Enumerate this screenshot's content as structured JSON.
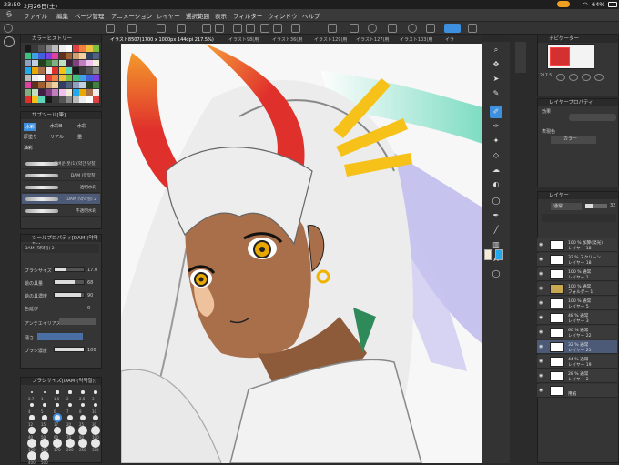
{
  "status": {
    "time": "23:50",
    "date": "2月26日(土)",
    "battery": "64%"
  },
  "menu": [
    "ファイル",
    "編集",
    "ページ管理",
    "アニメーション",
    "レイヤー",
    "選択範囲",
    "表示",
    "フィルター",
    "ウィンドウ",
    "ヘルプ"
  ],
  "tabs": [
    "イラスト8507(1700 x 1000px 144dpi 217.5%)",
    "イラスト98(用",
    "イラスト36(用",
    "イラスト129(用",
    "イラスト127(用",
    "イラスト103(用",
    "イラ"
  ],
  "color_history_title": "カラーヒストリー",
  "subtool_title": "サブツール[筆]",
  "subtools": [
    "水彩",
    "水彩B",
    "水彩",
    "厚塗り",
    "リアル",
    "墨",
    "油彩"
  ],
  "brushes": [
    {
      "name": "가벼운 붓(1)(약간 덧칠)"
    },
    {
      "name": "DAM (약약칠)"
    },
    {
      "name": "透明水彩"
    },
    {
      "name": "DAM (약약칠) 2"
    },
    {
      "name": "不透明水彩"
    }
  ],
  "tool_property": {
    "title": "ツールプロパティ[DAM (약약칠)]",
    "brush_name": "DAM (약약칠) 2",
    "brush_size_label": "ブラシサイズ",
    "brush_size": "17.0",
    "paint_amount_label": "絵の具量",
    "paint_amount": "68",
    "paint_density_label": "絵の具濃度",
    "paint_density": "90",
    "blend_label": "色延び",
    "blend": "0",
    "antialias_label": "アンチエイリアス",
    "hardness_label": "硬さ",
    "brush_density_label": "ブラシ濃度",
    "brush_density": "100"
  },
  "brush_size_panel": {
    "title": "ブラシサイズ[DAM (약약칠)]",
    "sizes": [
      "0.7",
      "1",
      "1.5",
      "2",
      "2.5",
      "3",
      "4",
      "5",
      "6",
      "7",
      "8",
      "10",
      "12",
      "15",
      "17",
      "20",
      "25",
      "30",
      "40",
      "50",
      "60",
      "70",
      "80",
      "100",
      "120",
      "150",
      "170",
      "200",
      "250",
      "300",
      "400",
      "500"
    ],
    "selected": "17"
  },
  "navigator_title": "ナビゲーター",
  "navigator_zoom": "217.5",
  "layer_property": {
    "title": "レイヤープロパティ",
    "effect_label": "効果",
    "expression_label": "表現色",
    "expression_value": "カラー"
  },
  "layer_panel": {
    "title": "レイヤー",
    "blend_mode": "通常",
    "opacity": "32",
    "layers": [
      {
        "op": "100 %",
        "mode": "加算(発光)",
        "name": "レイヤー 18"
      },
      {
        "op": "32 %",
        "mode": "スクリーン",
        "name": "レイヤー 18"
      },
      {
        "op": "100 %",
        "mode": "通常",
        "name": "レイヤー 1"
      },
      {
        "op": "100 %",
        "mode": "通常",
        "name": "フォルダー 1"
      },
      {
        "op": "100 %",
        "mode": "通常",
        "name": "レイヤー 5"
      },
      {
        "op": "48 %",
        "mode": "通常",
        "name": "レイヤー 3"
      },
      {
        "op": "60 %",
        "mode": "通常",
        "name": "レイヤー 22"
      },
      {
        "op": "32 %",
        "mode": "通常",
        "name": "レイヤー 21"
      },
      {
        "op": "44 %",
        "mode": "通常",
        "name": "レイヤー 19"
      },
      {
        "op": "28 %",
        "mode": "通常",
        "name": "レイヤー 2"
      },
      {
        "op": "",
        "mode": "",
        "name": "用紙"
      }
    ]
  },
  "colors": {
    "accent": "#3d8fe0",
    "selected_layer": "#4c5a78",
    "horn_red": "#e0302c",
    "horn_orange": "#f39a2c",
    "eye_gold": "#e8a800",
    "skin": "#a86f4a",
    "hair": "#ececec",
    "ornament": "#f6c21a"
  }
}
